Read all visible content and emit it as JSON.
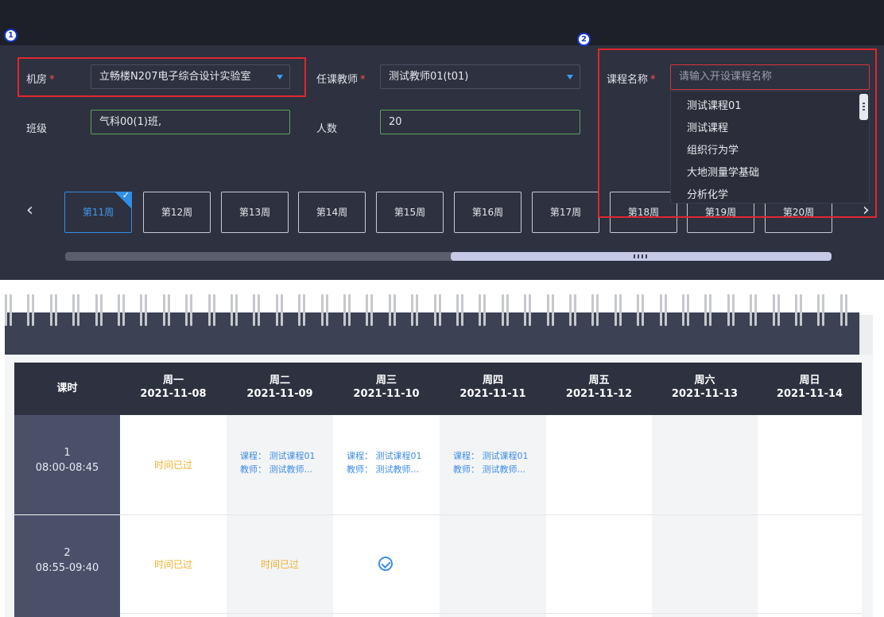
{
  "markers": {
    "one": "1",
    "two": "2"
  },
  "form": {
    "room_label": "机房",
    "room_value": "立畅楼N207电子综合设计实验室",
    "teacher_label": "任课教师",
    "teacher_value": "测试教师01(t01)",
    "course_label": "课程名称",
    "course_placeholder": "请输入开设课程名称",
    "class_label": "班级",
    "class_value": "气科00(1)班,",
    "count_label": "人数",
    "count_value": "20",
    "required_mark": "*"
  },
  "dropdown": {
    "options": [
      "测试课程01",
      "测试课程",
      "组织行为学",
      "大地测量学基础",
      "分析化学"
    ]
  },
  "weeks": {
    "prev_icon": "chevron-left-icon",
    "next_icon": "chevron-right-icon",
    "items": [
      "第11周",
      "第12周",
      "第13周",
      "第14周",
      "第15周",
      "第16周",
      "第17周",
      "第18周",
      "第19周",
      "第20周"
    ],
    "active_index": 0,
    "scroll_position": 0.5
  },
  "calendar": {
    "period_header": "课时",
    "days": [
      {
        "day": "周一",
        "date": "2021-11-08"
      },
      {
        "day": "周二",
        "date": "2021-11-09"
      },
      {
        "day": "周三",
        "date": "2021-11-10"
      },
      {
        "day": "周四",
        "date": "2021-11-11"
      },
      {
        "day": "周五",
        "date": "2021-11-12"
      },
      {
        "day": "周六",
        "date": "2021-11-13"
      },
      {
        "day": "周日",
        "date": "2021-11-14"
      }
    ],
    "periods": [
      {
        "num": "1",
        "time": "08:00-08:45"
      },
      {
        "num": "2",
        "time": "08:55-09:40"
      }
    ],
    "passed_text": "时间已过",
    "course_line": "课程：  测试课程01",
    "teacher_line": "教师：  测试教师...",
    "selected_icon": "check-circle-icon"
  },
  "colors": {
    "accent": "#2f8fe8",
    "highlight_frame": "#e0272e",
    "passed": "#f0b12e",
    "panel_bg": "#2e313f"
  }
}
